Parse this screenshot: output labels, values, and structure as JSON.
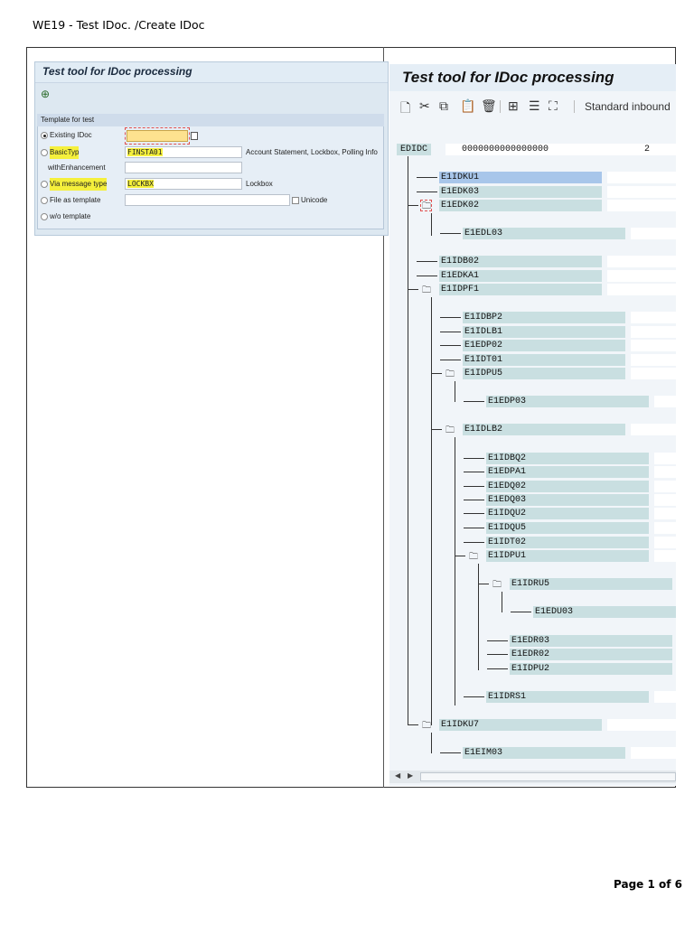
{
  "document": {
    "title": "WE19 - Test IDoc. /Create IDoc",
    "page_label": "Page 1 of 6"
  },
  "left_panel": {
    "title": "Test tool for IDoc processing",
    "execute_icon": "execute-icon",
    "group_title": "Template for test",
    "rows": {
      "existing_idoc": "Existing IDoc",
      "basic_type": "BasicTyp",
      "basic_type_value": "FINSTA01",
      "basic_type_desc": "Account Statement, Lockbox, Polling Info",
      "with_enhancement": "withEnhancement",
      "message_type": "Via message type",
      "message_type_value": "LOCKBX",
      "message_type_desc": "Lockbox",
      "file_template": "File as template",
      "unicode": "Unicode",
      "wo_template": "w/o template"
    }
  },
  "right_panel": {
    "title": "Test tool for IDoc processing",
    "toolbar": {
      "icons": [
        "new-doc-icon",
        "cut-icon",
        "copy-icon",
        "paste-icon",
        "delete-icon",
        "insert-segment-icon",
        "edit-segment-icon",
        "segment-data-icon"
      ],
      "standard_inbound": "Standard inbound"
    },
    "control_record": {
      "name": "EDIDC",
      "value": "0000000000000000",
      "count": "2"
    },
    "segments": [
      "E1IDKU1",
      "E1EDK03",
      "E1EDK02",
      "E1EDL03",
      "E1IDB02",
      "E1EDKA1",
      "E1IDPF1",
      "E1IDBP2",
      "E1IDLB1",
      "E1EDP02",
      "E1IDT01",
      "E1IDPU5",
      "E1EDP03",
      "E1IDLB2",
      "E1IDBQ2",
      "E1EDPA1",
      "E1EDQ02",
      "E1EDQ03",
      "E1IDQU2",
      "E1IDQU5",
      "E1IDT02",
      "E1IDPU1",
      "E1IDRU5",
      "E1EDU03",
      "E1EDR03",
      "E1EDR02",
      "E1IDPU2",
      "E1IDRS1",
      "E1IDKU7",
      "E1EIM03"
    ]
  }
}
